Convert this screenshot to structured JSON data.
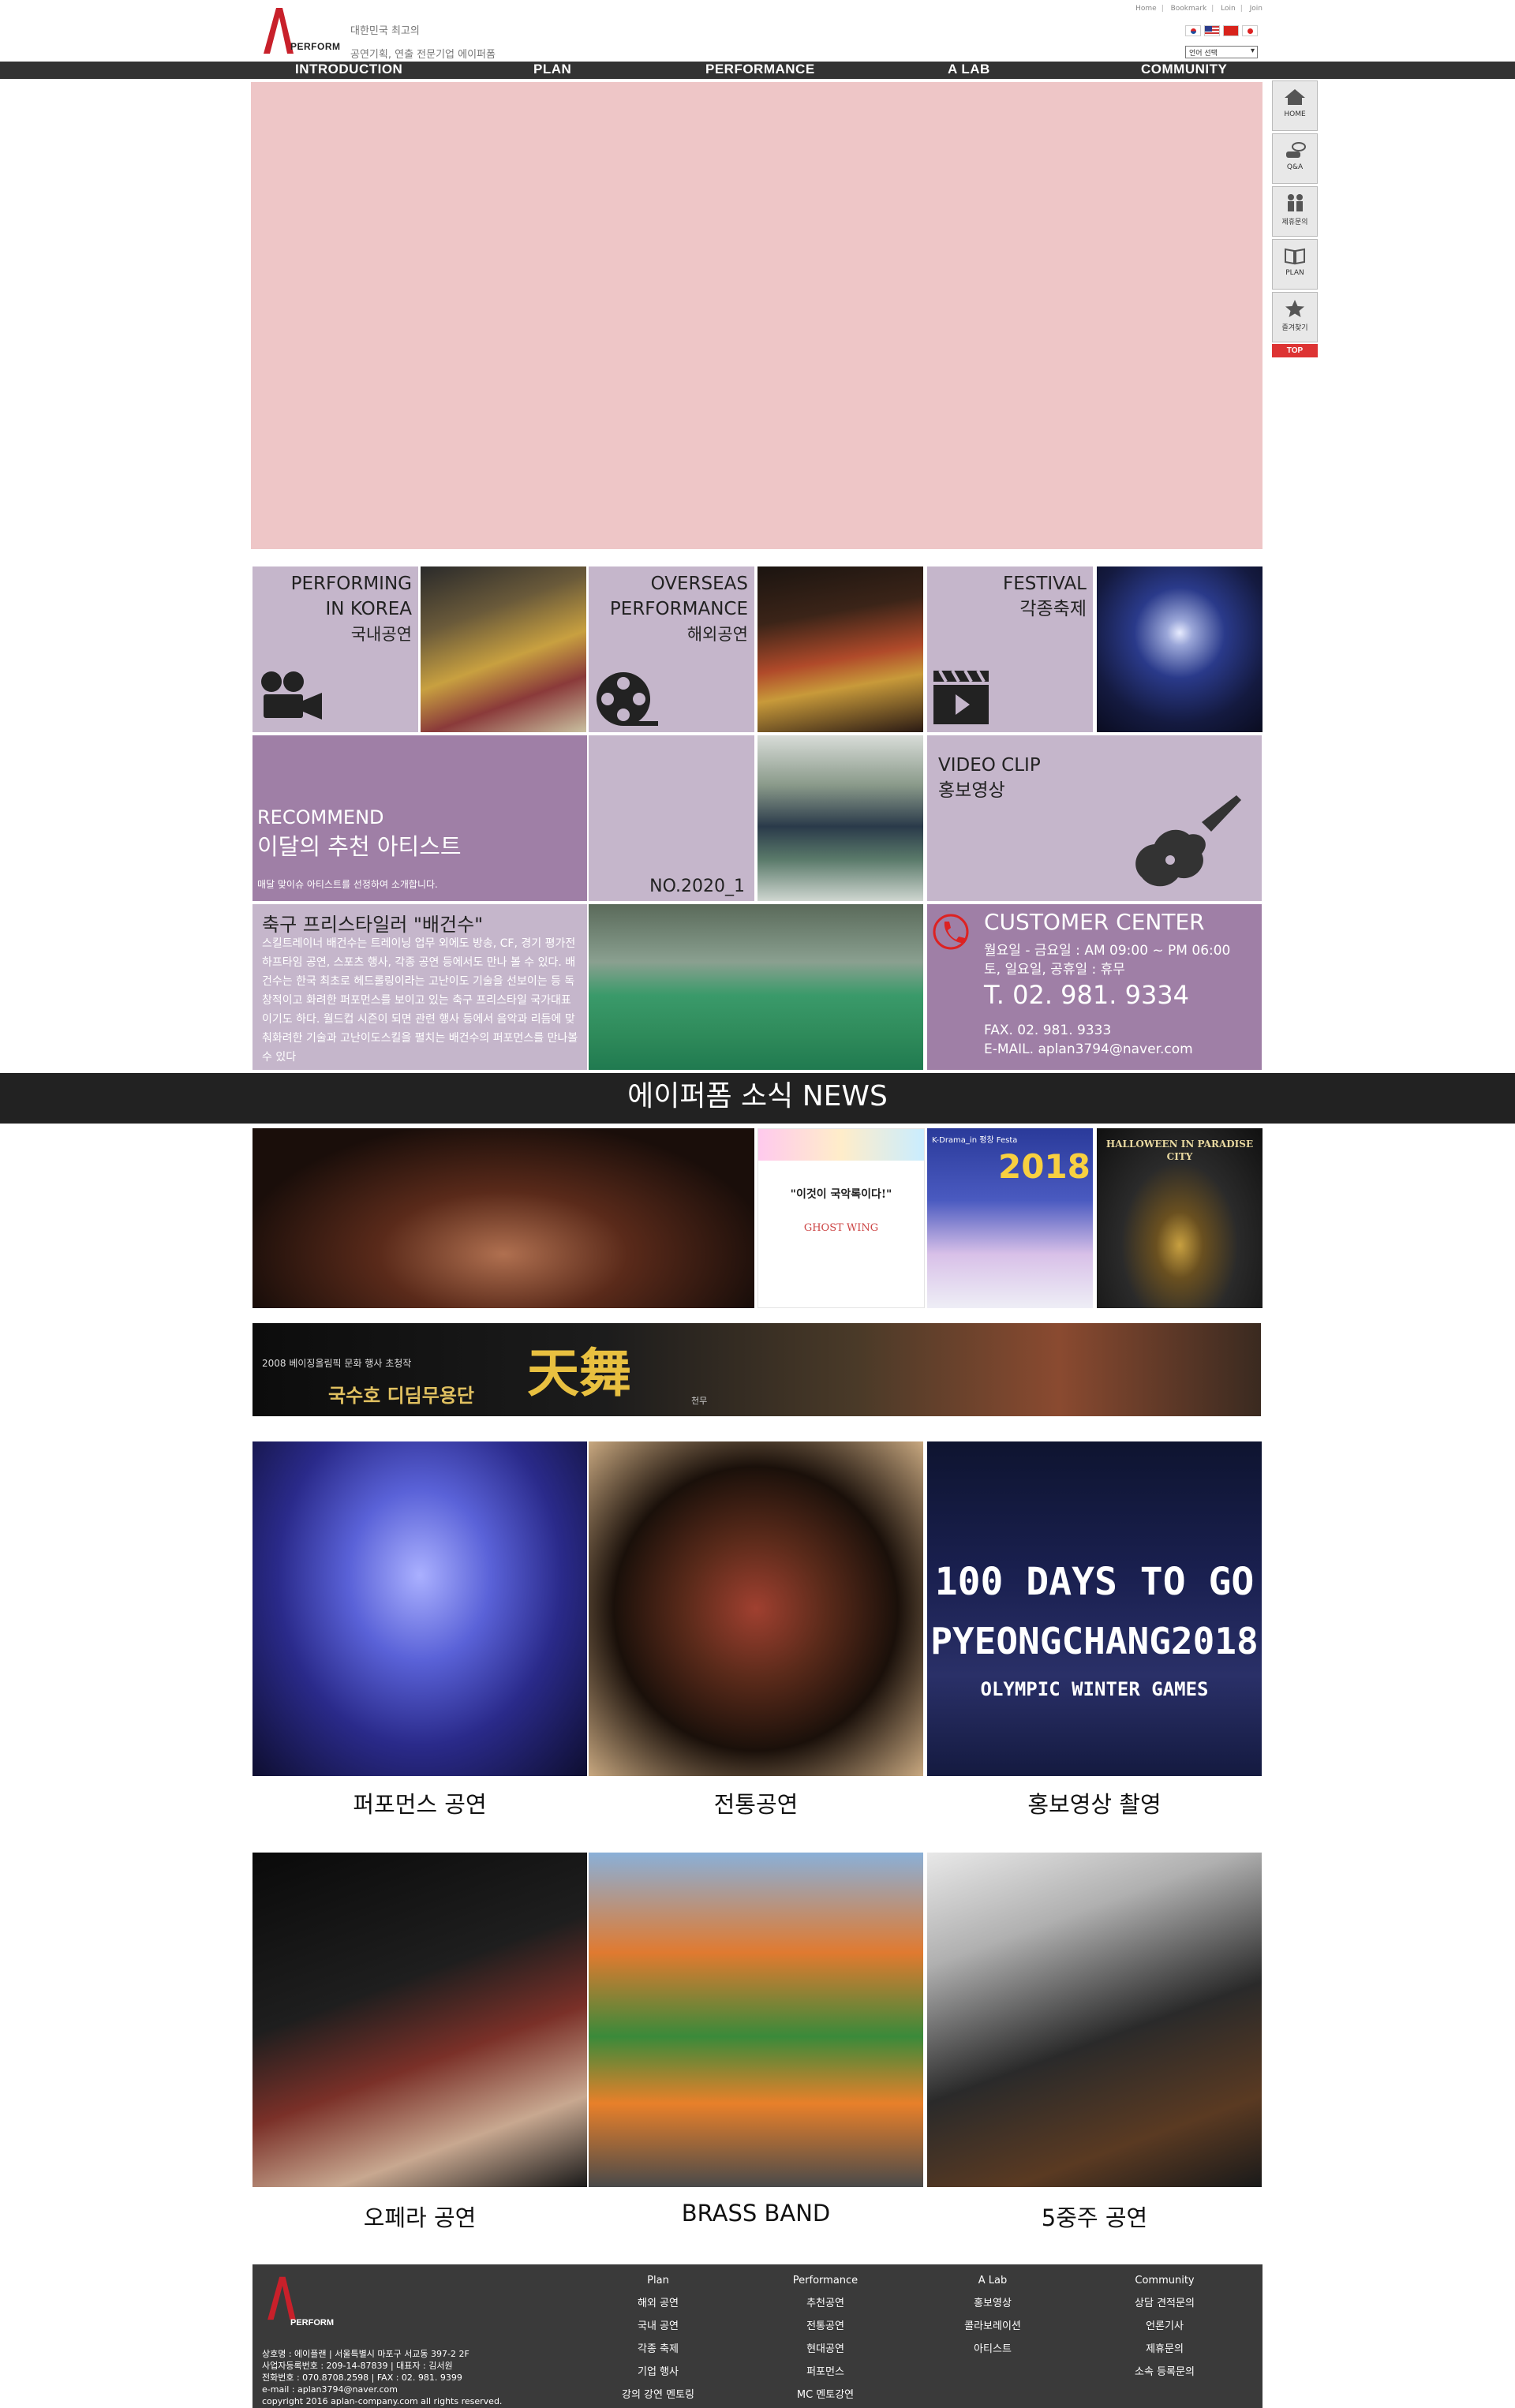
{
  "header": {
    "logo_text": "PERFORM",
    "tagline_1": "대한민국 최고의",
    "tagline_2": "공연기획, 연출 전문기업 에이퍼폼",
    "top_links": [
      "Home",
      "Bookmark",
      "Loin",
      "Join"
    ],
    "language_select": "언어 선택",
    "flags": [
      "korea-flag-icon",
      "usa-flag-icon",
      "china-flag-icon",
      "japan-flag-icon"
    ]
  },
  "nav": {
    "items": [
      "INTRODUCTION",
      "PLAN",
      "PERFORMANCE",
      "A LAB",
      "COMMUNITY"
    ]
  },
  "quick_menu": {
    "items": [
      "HOME",
      "Q&A",
      "제휴문의",
      "PLAN",
      "즐겨찾기"
    ],
    "top": "TOP"
  },
  "tiles": {
    "korea": {
      "line1": "PERFORMING",
      "line2": "IN KOREA",
      "line3": "국내공연"
    },
    "overseas": {
      "line1": "OVERSEAS",
      "line2": "PERFORMANCE",
      "line3": "해외공연"
    },
    "festival": {
      "line1": "FESTIVAL",
      "line2": "각종축제"
    },
    "recommend": {
      "en": "RECOMMEND",
      "ko": "이달의 추천 아티스트",
      "desc": "매달 맞이슈 아티스트를 선정하여 소개합니다."
    },
    "number": "NO.2020_1",
    "video": {
      "line1": "VIDEO CLIP",
      "line2": "홍보영상"
    },
    "artist": {
      "title": "축구 프리스타일러 \"배건수\"",
      "body": "스킬트레이너 배건수는 트레이닝 업무 외에도 방송, CF, 경기 평가전 하프타임 공연, 스포츠 행사, 각종 공연 등에서도 만나 볼 수 있다. 배건수는 한국 최초로 헤드롤링이라는 고난이도 기술을 선보이는 등 독창적이고 화려한 퍼포먼스를 보이고 있는 축구 프리스타일 국가대표이기도 하다. 월드컵 시즌이 되면 관련 행사 등에서 음악과 리듬에 맞춰화려한 기술과 고난이도스킬을 펼치는 배건수의 퍼포먼스를 만나볼 수 있다"
    },
    "customer": {
      "title": "CUSTOMER CENTER",
      "hours1": "월요일 - 금요일 : AM 09:00 ~ PM 06:00",
      "hours2": "토, 일요일, 공휴일 : 휴무",
      "tel": "T. 02. 981. 9334",
      "fax": "FAX. 02. 981. 9333",
      "email": "E-MAIL. aplan3794@naver.com"
    }
  },
  "news": {
    "title": "에이퍼폼 소식 NEWS",
    "banner_1": "2008 베이징올림픽 문화 행사 초청작",
    "banner_2": "국수호 디딤무용단",
    "banner_3": "天舞",
    "banner_4": "천무",
    "poster_ghost": "GHOST WING",
    "poster_ghost_top": "\"이것이 국악록이다!\"",
    "poster_kdrama": "K-Drama_in 평창 Festa",
    "poster_kdrama_year": "2018",
    "poster_halloween": "HALLOWEEN IN PARADISE CITY",
    "olympic_1": "100 DAYS TO GO",
    "olympic_2": "PYEONGCHANG2018",
    "olympic_3": "OLYMPIC WINTER GAMES"
  },
  "captions": [
    "퍼포먼스 공연",
    "전통공연",
    "홍보영상 촬영",
    "오페라 공연",
    "BRASS BAND",
    "5중주 공연"
  ],
  "footer": {
    "logo_text": "PERFORM",
    "columns": [
      {
        "head": "Plan",
        "items": [
          "해외 공연",
          "국내 공연",
          "각종 축제",
          "기업 행사",
          "강의 강연 멘토링"
        ]
      },
      {
        "head": "Performance",
        "items": [
          "추천공연",
          "전통공연",
          "현대공연",
          "퍼포먼스",
          "MC 멘토강연"
        ]
      },
      {
        "head": "A Lab",
        "items": [
          "홍보영상",
          "콜라보레이션",
          "아티스트"
        ]
      },
      {
        "head": "Community",
        "items": [
          "상담 견적문의",
          "언론기사",
          "제휴문의",
          "소속 등록문의"
        ]
      }
    ],
    "info": [
      "상호명 : 에이플랜 | 서울특별시 마포구 서교동 397-2 2F",
      "사업자등록번호 : 209-14-87839 | 대표자 : 김서원",
      "전화번호 : 070.8708.2598 | FAX : 02. 981. 9399",
      "e-mail : aplan3794@naver.com",
      "copyright 2016 aplan-company.com all rights reserved."
    ]
  }
}
